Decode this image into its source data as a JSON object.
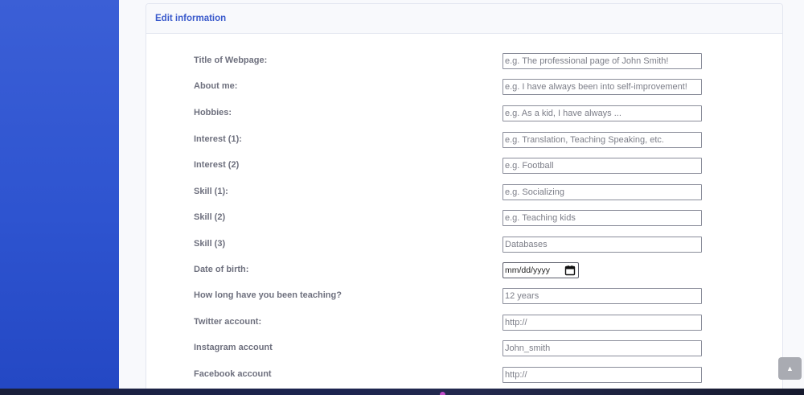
{
  "card": {
    "title": "Edit information"
  },
  "form": {
    "title_of_webpage": {
      "label": "Title of Webpage:",
      "placeholder": "e.g. The professional page of John Smith!"
    },
    "about_me": {
      "label": "About me:",
      "placeholder": "e.g. I have always been into self-improvement!"
    },
    "hobbies": {
      "label": "Hobbies:",
      "placeholder": "e.g. As a kid, I have always ..."
    },
    "interest_1": {
      "label": "Interest (1):",
      "placeholder": "e.g. Translation, Teaching Speaking, etc."
    },
    "interest_2": {
      "label": "Interest (2)",
      "placeholder": "e.g. Football"
    },
    "skill_1": {
      "label": "Skill (1):",
      "placeholder": "e.g. Socializing"
    },
    "skill_2": {
      "label": "Skill (2)",
      "placeholder": "e.g. Teaching kids"
    },
    "skill_3": {
      "label": "Skill (3)",
      "placeholder": "Databases"
    },
    "date_of_birth": {
      "label": "Date of birth:",
      "value": "mm/dd/yyyy"
    },
    "teaching_duration": {
      "label": "How long have you been teaching?",
      "placeholder": "12 years"
    },
    "twitter": {
      "label": "Twitter account:",
      "placeholder": "http://"
    },
    "instagram": {
      "label": "Instagram account",
      "placeholder": "John_smith"
    },
    "facebook": {
      "label": "Facebook account",
      "placeholder": "http://"
    }
  },
  "scroll_top": {
    "icon": "chevron-up-icon",
    "glyph": "▲"
  },
  "colors": {
    "sidebar": "#2e54d0",
    "accent": "#3b5bcc",
    "page_bg": "#f8f9fc"
  }
}
